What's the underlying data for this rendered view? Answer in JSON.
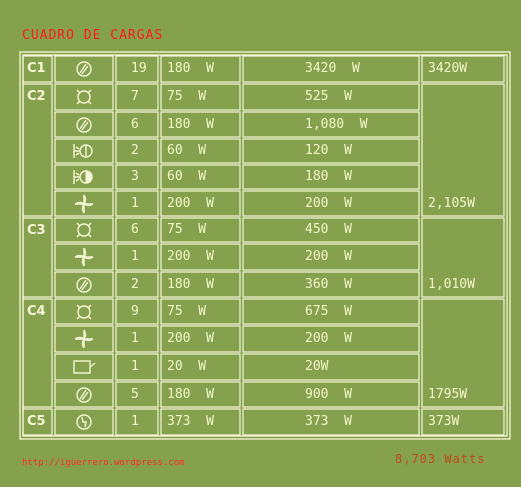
{
  "title": "CUADRO DE CARGAS",
  "footer": {
    "url": "http://iguerrero.wordpress.com",
    "total": "8,703 Watts"
  },
  "colors": {
    "background": "#86a14e",
    "lines": "#f4f7d6",
    "title": "#ff1a1a",
    "text": "#f2f7c8"
  },
  "circuits": [
    {
      "name": "C1",
      "total": "3420W",
      "rows": [
        {
          "icon": "receptacle-icon",
          "qty": "19",
          "unit": "180  W",
          "subtotal": "3420  W"
        }
      ]
    },
    {
      "name": "C2",
      "total": "2,105W",
      "rows": [
        {
          "icon": "ceiling-light-icon",
          "qty": "7",
          "unit": "75  W",
          "subtotal": "525  W"
        },
        {
          "icon": "receptacle-icon",
          "qty": "6",
          "unit": "180  W",
          "subtotal": "1,080  W"
        },
        {
          "icon": "wall-light-icon",
          "qty": "2",
          "unit": "60  W",
          "subtotal": "120  W"
        },
        {
          "icon": "half-wall-light-icon",
          "qty": "3",
          "unit": "60  W",
          "subtotal": "180  W"
        },
        {
          "icon": "ceiling-fan-icon",
          "qty": "1",
          "unit": "200  W",
          "subtotal": "200  W"
        }
      ]
    },
    {
      "name": "C3",
      "total": "1,010W",
      "rows": [
        {
          "icon": "ceiling-light-icon",
          "qty": "6",
          "unit": "75  W",
          "subtotal": "450  W"
        },
        {
          "icon": "ceiling-fan-icon",
          "qty": "1",
          "unit": "200  W",
          "subtotal": "200  W"
        },
        {
          "icon": "receptacle-icon",
          "qty": "2",
          "unit": "180  W",
          "subtotal": "360  W"
        }
      ]
    },
    {
      "name": "C4",
      "total": "1795W",
      "rows": [
        {
          "icon": "ceiling-light-icon",
          "qty": "9",
          "unit": "75  W",
          "subtotal": "675  W"
        },
        {
          "icon": "ceiling-fan-icon",
          "qty": "1",
          "unit": "200  W",
          "subtotal": "200  W"
        },
        {
          "icon": "doorbell-icon",
          "qty": "1",
          "unit": "20  W",
          "subtotal": "20W"
        },
        {
          "icon": "receptacle-icon",
          "qty": "5",
          "unit": "180  W",
          "subtotal": "900  W"
        }
      ]
    },
    {
      "name": "C5",
      "total": "373W",
      "rows": [
        {
          "icon": "motor-icon",
          "qty": "1",
          "unit": "373  W",
          "subtotal": "373  W"
        }
      ]
    }
  ]
}
